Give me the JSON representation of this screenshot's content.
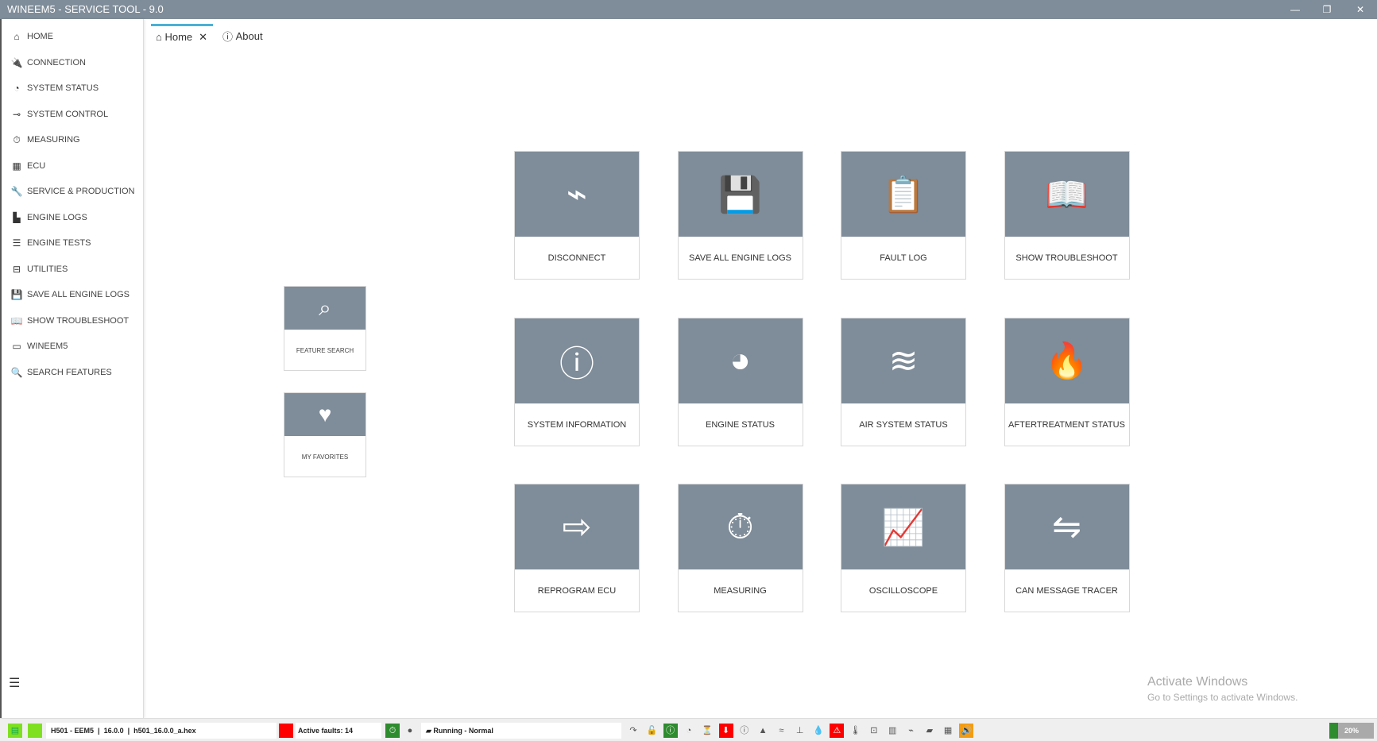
{
  "window": {
    "title": "WINEEM5 - SERVICE TOOL - 9.0"
  },
  "sidebar": {
    "items": [
      {
        "label": "HOME",
        "icon": "⌂"
      },
      {
        "label": "CONNECTION",
        "icon": "🔌"
      },
      {
        "label": "SYSTEM STATUS",
        "icon": "◔"
      },
      {
        "label": "SYSTEM CONTROL",
        "icon": "⊸"
      },
      {
        "label": "MEASURING",
        "icon": "⏱"
      },
      {
        "label": "ECU",
        "icon": "▦"
      },
      {
        "label": "SERVICE & PRODUCTION",
        "icon": "🔧"
      },
      {
        "label": "ENGINE LOGS",
        "icon": "▙"
      },
      {
        "label": "ENGINE TESTS",
        "icon": "☰"
      },
      {
        "label": "UTILITIES",
        "icon": "⊟"
      },
      {
        "label": "SAVE ALL ENGINE LOGS",
        "icon": "💾"
      },
      {
        "label": "SHOW TROUBLESHOOT",
        "icon": "📖"
      },
      {
        "label": "WINEEM5",
        "icon": "▭"
      },
      {
        "label": "SEARCH FEATURES",
        "icon": "🔍"
      }
    ]
  },
  "tabs": {
    "home": "Home",
    "about": "About"
  },
  "side_tiles": [
    {
      "label": "FEATURE SEARCH",
      "icon": "⌕"
    },
    {
      "label": "MY FAVORITES",
      "icon": "♥"
    }
  ],
  "tiles": [
    {
      "label": "DISCONNECT",
      "icon": "⌁"
    },
    {
      "label": "SAVE ALL ENGINE LOGS",
      "icon": "💾"
    },
    {
      "label": "FAULT LOG",
      "icon": "📋"
    },
    {
      "label": "SHOW TROUBLESHOOT",
      "icon": "📖"
    },
    {
      "label": "SYSTEM INFORMATION",
      "icon": "ⓘ"
    },
    {
      "label": "ENGINE STATUS",
      "icon": "◕"
    },
    {
      "label": "AIR SYSTEM STATUS",
      "icon": "≋"
    },
    {
      "label": "AFTERTREATMENT STATUS",
      "icon": "🔥"
    },
    {
      "label": "REPROGRAM ECU",
      "icon": "⇨"
    },
    {
      "label": "MEASURING",
      "icon": "⏱"
    },
    {
      "label": "OSCILLOSCOPE",
      "icon": "📈"
    },
    {
      "label": "CAN MESSAGE TRACER",
      "icon": "⇋"
    }
  ],
  "status": {
    "ecu": "H501 - EEM5",
    "version": "16.0.0",
    "file": "h501_16.0.0_a.hex",
    "faults": "Active faults: 14",
    "engine": "Running - Normal",
    "progress": "20%",
    "progress_value": 20,
    "colors": {
      "green": "#7fe022",
      "red": "#ff0000",
      "dark_green": "#2e8b2e",
      "orange": "#f39c12"
    }
  },
  "watermark": {
    "line1": "Activate Windows",
    "line2": "Go to Settings to activate Windows."
  }
}
